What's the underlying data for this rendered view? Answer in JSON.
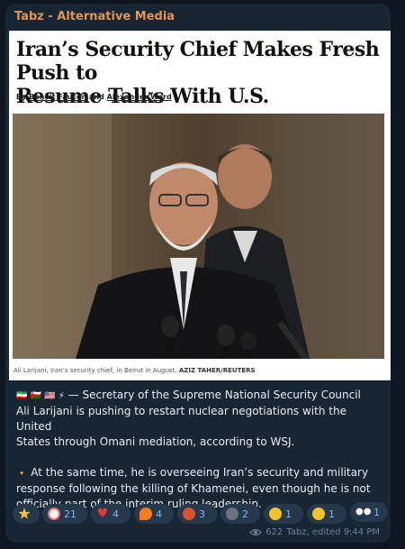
{
  "channel": {
    "name": "Tabz - Alternative Media"
  },
  "article": {
    "headline_line1": "Iran’s Security Chief Makes Fresh Push to",
    "headline_line2": "Resume Talks With U.S.",
    "byline_prefix": "By",
    "author1": "Benoit Faucon",
    "byline_and": "and",
    "author2": "Alexander Ward",
    "caption": "Ali Larijani, Iran’s security chief, in Beirut in August.",
    "caption_credit": "AZIZ TAHER/REUTERS"
  },
  "message": {
    "flags": "🇮🇷 🇴🇲 🇺🇸 ⚡",
    "line1": " — Secretary of the Supreme National Security Council",
    "line2": "Ali Larijani is pushing to restart nuclear negotiations with the United",
    "line3": "States through Omani mediation, according to WSJ.",
    "bullet": "🔸",
    "line4": " At the same time, he is overseeing Iran’s security and military",
    "line5": "response following the killing of Khamenei, even though he is not",
    "line6": "officially part of the interim ruling leadership."
  },
  "reactions": [
    {
      "icon": "star-icon",
      "count": "",
      "color": "#f5c542"
    },
    {
      "icon": "clown-face-icon",
      "count": "21",
      "color": "#f0a0a0"
    },
    {
      "icon": "heart-icon",
      "count": "4",
      "color": "#e53935"
    },
    {
      "icon": "fire-icon",
      "count": "4",
      "color": "#ff7a1a"
    },
    {
      "icon": "angry-face-icon",
      "count": "3",
      "color": "#d9542a"
    },
    {
      "icon": "moon-face-icon",
      "count": "2",
      "color": "#6b7380"
    },
    {
      "icon": "grinning-face-icon",
      "count": "1",
      "color": "#f2c12e"
    },
    {
      "icon": "raised-eyebrow-face-icon",
      "count": "1",
      "color": "#f2c12e"
    },
    {
      "icon": "eyes-icon",
      "count": "1",
      "color": "#ffffff"
    }
  ],
  "meta": {
    "views": "622",
    "author": "Tabz, edited 9:44 PM"
  }
}
